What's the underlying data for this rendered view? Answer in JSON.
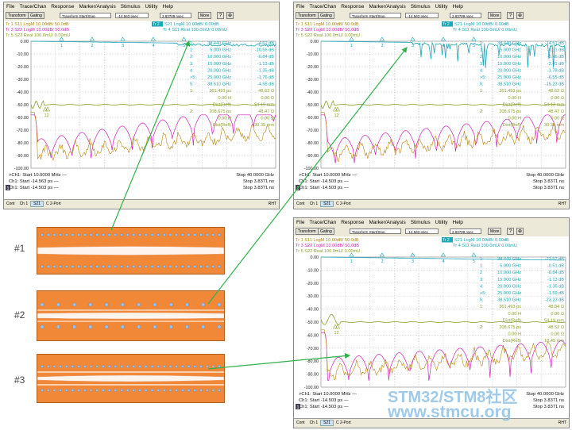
{
  "menu": [
    "File",
    "Trace/Chan",
    "Response",
    "Marker/Analysis",
    "Stimulus",
    "Utility",
    "Help"
  ],
  "toolbar": {
    "transform": "Transform",
    "gating": "Gating",
    "mode": "Transform Start/Stop",
    "start": "-14.563 psec",
    "stop": "3.83709 nsec",
    "more": "More"
  },
  "status": {
    "cont": "Cont",
    "ch": "Ch 1",
    "meas": "S21",
    "port": "C 2-Port",
    "rht": "RHT"
  },
  "panels": [
    {
      "traces": {
        "tr1": "Tr 1  S11 LogM 10.00dB/  50.0dB",
        "tr3": "Tr 3  S22 LogM 10.00dB/  50.0dB",
        "tr5": "Tr 5  S22 Real 100.0mU/  0.00mU",
        "tr2": "S21 LogM 10.00dB/  0.00dB",
        "tr4": "Tr 4  S11 Real 100.0mU/  0.00mU",
        "active": "Tr 2"
      },
      "markers": [
        [
          "1:",
          "38.440 GHz",
          "-4.62 dB"
        ],
        [
          "1:",
          "5.000 GHz",
          "-10.56 dB"
        ],
        [
          "2:",
          "10.000 GHz",
          "-0.84 dB"
        ],
        [
          "3:",
          "15.000 GHz",
          "-1.13 dB"
        ],
        [
          "4:",
          "20.000 GHz",
          "-1.35 dB"
        ],
        [
          ">5:",
          "25.000 GHz",
          "-1.76 dB"
        ],
        [
          "5:",
          "38.510 GHz",
          "-4.58 dB"
        ],
        [
          "1:",
          "361.493 ps",
          "48.63 Ω"
        ],
        [
          "",
          "0.00 H",
          "0.00 Ω"
        ],
        [
          "",
          "Dist(Refl)",
          "54.19 mm"
        ],
        [
          "2:",
          "208.675 ps",
          "48.47 Ω"
        ],
        [
          "",
          "0.00 H",
          "0.00 Ω"
        ],
        [
          "",
          "Dist(Refl)",
          "30.35 mm"
        ]
      ],
      "footer": {
        "l1": ">Ch1: Start  10.0000 MHz  —",
        "r1": "Stop  40.0000 GHz",
        "l2": "Ch1: Start -14.563 ps  —",
        "r2": "Stop  3.8371 ns",
        "l3": "Ch1: Start -14.503 ps  —",
        "r3": "Stop  3.8371 ns",
        "num": "1"
      }
    },
    {
      "traces": {
        "tr1": "Tr 1  S11 LogM 10.00dB/  50.0dB",
        "tr3": "Tr 3  S22 LogM 10.00dB/  50.0dB",
        "tr5": "Tr 5  S22 Real 100.0mU/  0.00mU",
        "tr2": "S21 LogM 10.00dB/  0.00dB",
        "tr4": "Tr 4  S11 Real 100.0mU/  0.00mU",
        "active": "Tr 2"
      },
      "markers": [
        [
          "1:",
          "38.440 GHz",
          "-14.51 dB"
        ],
        [
          "1:",
          "5.000 GHz",
          "-0.31 dB"
        ],
        [
          "2:",
          "10.000 GHz",
          "-0.46 dB"
        ],
        [
          "3:",
          "15.000 GHz",
          "-2.41 dB"
        ],
        [
          "4:",
          "20.000 GHz",
          "-1.78 dB"
        ],
        [
          ">5:",
          "25.000 GHz",
          "-6.55 dB"
        ],
        [
          "5:",
          "38.510 GHz",
          "-15.23 dB"
        ],
        [
          "1:",
          "361.493 ps",
          "48.62 Ω"
        ],
        [
          "",
          "0.00 H",
          "0.00 Ω"
        ],
        [
          "",
          "Dist(Refl)",
          "54.13 mm"
        ],
        [
          "2:",
          "208.675 ps",
          "48.47 Ω"
        ],
        [
          "",
          "0.00 H",
          "0.00 Ω"
        ],
        [
          "",
          "Dist(Refl)",
          "30.35 mm"
        ]
      ],
      "footer": {
        "l1": ">Ch1: Start  10.0000 MHz  —",
        "r1": "Stop  40.0000 GHz",
        "l2": "Ch1: Start -14.503 ps  —",
        "r2": "Stop  3.8371 ns",
        "l3": "Ch1: Start -14.503 ps  —",
        "r3": "Stop  3.8371 ns",
        "num": "1"
      }
    },
    {
      "traces": {
        "tr1": "Tr 1  S11 LogM 10.00dB/  50.0dB",
        "tr3": "Tr 3  S22 LogM 10.00dB/  50.0dB",
        "tr5": "Tr 5  S22 Real 100.0mU/  0.00mU",
        "tr2": "S21 LogM 10.00dB/  0.00dB",
        "tr4": "Tr 4  S11 Real 100.0mU/  0.00mU",
        "active": "Tr 2"
      },
      "markers": [
        [
          "1:",
          "38.440 GHz",
          "-23.52 dB"
        ],
        [
          "1:",
          "5.000 GHz",
          "-0.51 dB"
        ],
        [
          "2",
          "10.000 GHz",
          "-0.84 dB"
        ],
        [
          "3:",
          "15.000 GHz",
          "-1.13 dB"
        ],
        [
          "4:",
          "20.000 GHz",
          "-1.35 dB"
        ],
        [
          ">5:",
          "25.000 GHz",
          "-1.59 dB"
        ],
        [
          "5:",
          "38.510 GHz",
          "-23.23 dB"
        ],
        [
          "1:",
          "361.493 ps",
          "48.04 Ω"
        ],
        [
          "",
          "0.00 H",
          "0.00 Ω"
        ],
        [
          "",
          "Dist(Refl)",
          "54.19 mm"
        ],
        [
          "2:",
          "208.675 ps",
          "48.52 Ω"
        ],
        [
          "",
          "0.00 H",
          "0.00 Ω"
        ],
        [
          "",
          "Dist(Refl)",
          "10.45 mm"
        ]
      ],
      "footer": {
        "l1": ">Ch1: Start  10.0000 MHz  —",
        "r1": "Stop  40.0000 GHz",
        "l2": "Ch1: Start -14.503 ps  —",
        "r2": "Stop  3.8371 ns",
        "l3": "Ch1: Start -14.503 ps  —",
        "r3": "Stop  3.8371 ns",
        "num": "1"
      }
    }
  ],
  "chart_data": {
    "type": "line",
    "y_ticks": [
      "0.00",
      "-10.00",
      "-20.00",
      "-30.00",
      "-40.00",
      "-50.00",
      "-60.00",
      "-70.00",
      "-80.00",
      "-90.00",
      "-100.00"
    ],
    "ylim": [
      -100,
      0
    ],
    "xlim_ghz": [
      0.01,
      40
    ],
    "marker_freqs_ghz": [
      5,
      10,
      15,
      20,
      25,
      38.44
    ],
    "marker_ids": [
      "1",
      "2",
      "3",
      "4",
      "5"
    ],
    "time_markers": [
      "1",
      "2"
    ],
    "colors": {
      "s21": "#1aa7b8",
      "s11": "#b8860b",
      "s22": "#d020b8",
      "real": "#8aa12a"
    }
  },
  "pcb_labels": [
    "#1",
    "#2",
    "#3"
  ],
  "watermark": {
    "line1": "STM32/STM8社区",
    "line2": "www.stmcu.org"
  }
}
